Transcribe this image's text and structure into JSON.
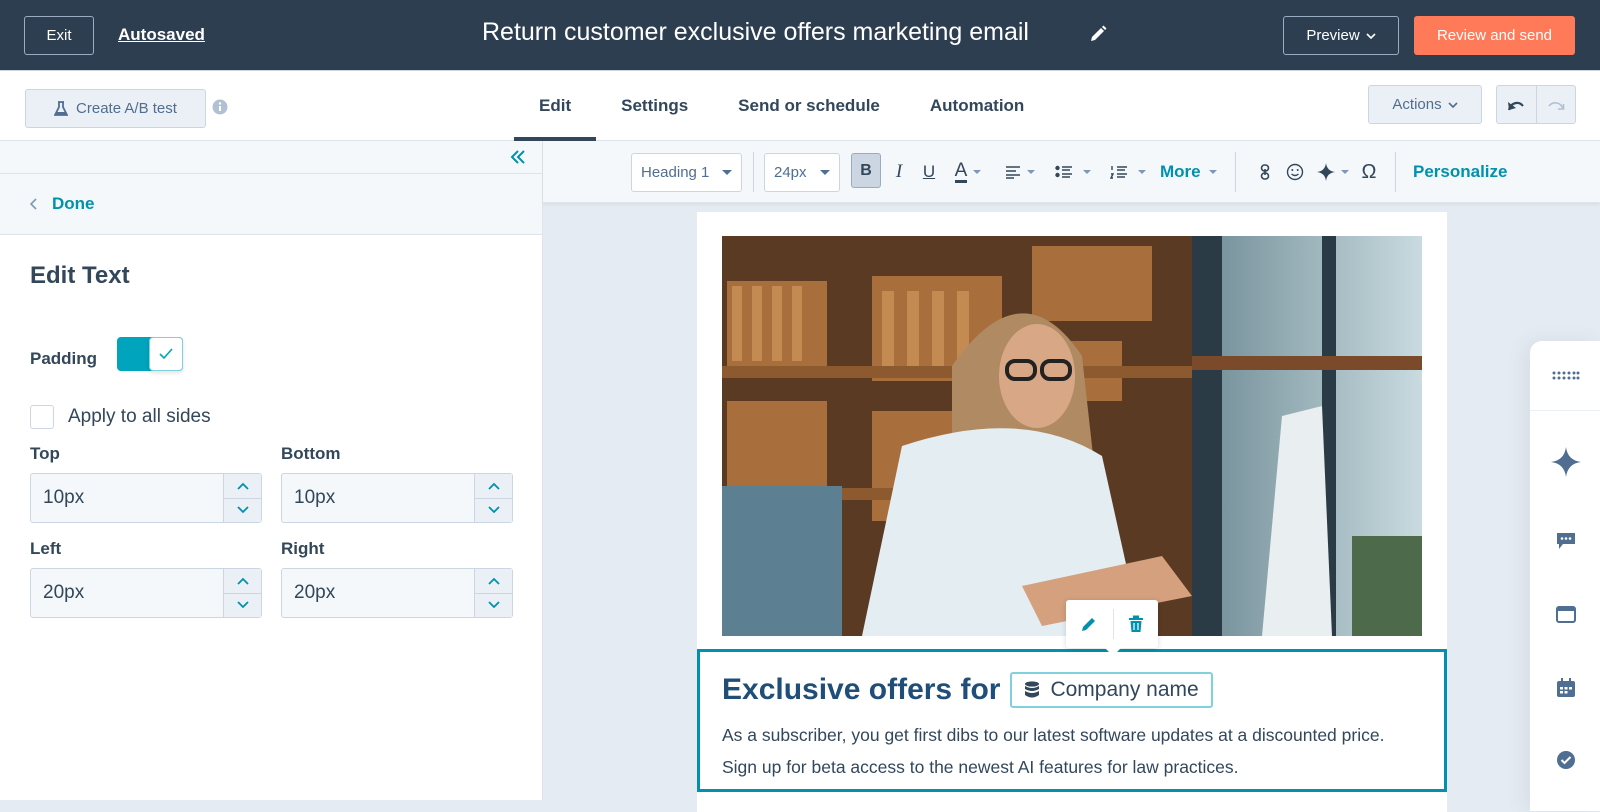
{
  "topbar": {
    "exit_label": "Exit",
    "autosaved_label": "Autosaved",
    "title": "Return customer exclusive offers marketing email",
    "preview_label": "Preview",
    "review_label": "Review and send",
    "accent_color": "#ff7a59"
  },
  "tabbar": {
    "ab_test_label": "Create A/B test",
    "tabs": [
      {
        "label": "Edit",
        "active": true
      },
      {
        "label": "Settings",
        "active": false
      },
      {
        "label": "Send or schedule",
        "active": false
      },
      {
        "label": "Automation",
        "active": false
      }
    ],
    "actions_label": "Actions"
  },
  "left_panel": {
    "done_label": "Done",
    "title": "Edit Text",
    "padding_label": "Padding",
    "padding_enabled": true,
    "apply_all_label": "Apply to all sides",
    "apply_all_checked": false,
    "fields": {
      "top": {
        "label": "Top",
        "value": "10px"
      },
      "bottom": {
        "label": "Bottom",
        "value": "10px"
      },
      "left": {
        "label": "Left",
        "value": "20px"
      },
      "right": {
        "label": "Right",
        "value": "20px"
      }
    }
  },
  "toolbar": {
    "style_select": "Heading 1",
    "size_select": "24px",
    "bold": "B",
    "italic": "I",
    "underline": "U",
    "text_color": "A",
    "more_label": "More",
    "omega": "Ω",
    "personalize_label": "Personalize"
  },
  "email": {
    "hero_alt": "Woman with glasses working at a computer in a law library",
    "headline": "Exclusive offers for",
    "token_label": "Company name",
    "body": "As a subscriber, you get first dibs to our latest software updates at a discounted price. Sign up for beta access to the newest AI features for law practices."
  },
  "dock": {
    "items": [
      "grid-icon",
      "sparkle-icon",
      "chat-icon",
      "browser-icon",
      "calendar-icon",
      "verified-icon"
    ]
  }
}
